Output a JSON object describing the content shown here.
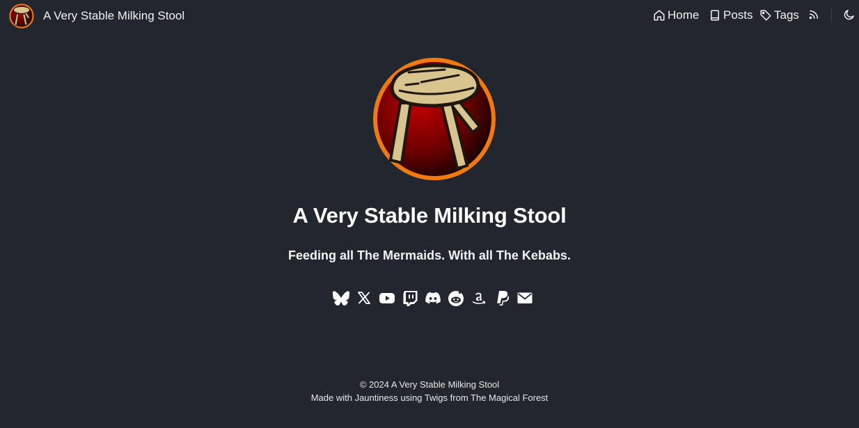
{
  "header": {
    "site_title": "A Very Stable Milking Stool",
    "logo_icon": "milking-stool-logo",
    "nav": {
      "home": {
        "label": "Home",
        "icon": "home-icon"
      },
      "posts": {
        "label": "Posts",
        "icon": "book-icon"
      },
      "tags": {
        "label": "Tags",
        "icon": "tag-icon"
      },
      "rss": {
        "icon": "rss-icon"
      },
      "theme": {
        "icon": "moon-icon"
      }
    }
  },
  "hero": {
    "title": "A Very Stable Milking Stool",
    "subtitle": "Feeding all The Mermaids. With all The Kebabs.",
    "avatar_icon": "milking-stool-avatar"
  },
  "social_links": [
    {
      "name": "bluesky",
      "icon": "bluesky-icon"
    },
    {
      "name": "x",
      "icon": "x-icon"
    },
    {
      "name": "youtube",
      "icon": "youtube-icon"
    },
    {
      "name": "twitch",
      "icon": "twitch-icon"
    },
    {
      "name": "discord",
      "icon": "discord-icon"
    },
    {
      "name": "reddit",
      "icon": "reddit-icon"
    },
    {
      "name": "amazon",
      "icon": "amazon-icon"
    },
    {
      "name": "paypal",
      "icon": "paypal-icon"
    },
    {
      "name": "email",
      "icon": "email-icon"
    }
  ],
  "footer": {
    "copyright": "© 2024 A Very Stable Milking Stool",
    "made_with_prefix": "Made with ",
    "theme_name": "Jauntiness",
    "using_text": " using ",
    "author_name": "Twigs",
    "from_text": " from ",
    "forest_name": "The Magical Forest"
  },
  "colors": {
    "background": "#22262e",
    "text": "#ffffff",
    "avatar_ring": "#f07a12",
    "avatar_fill": "#a30000",
    "stool_wood": "#d8c48e"
  }
}
